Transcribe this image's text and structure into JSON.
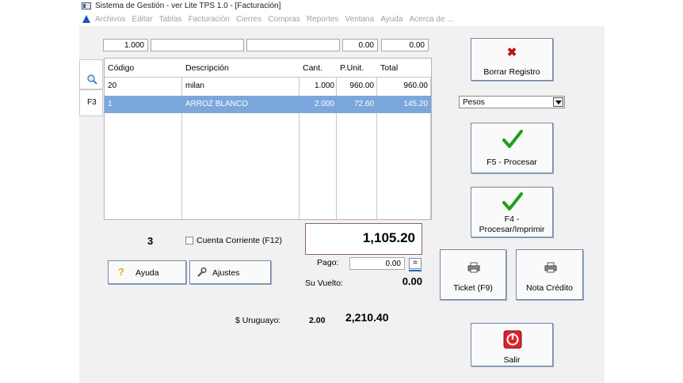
{
  "window": {
    "title": "Sistema de Gestión - ver Lite TPS 1.0 - [Facturación]"
  },
  "menu": {
    "items": [
      "Archivos",
      "Editar",
      "Tablas",
      "Facturación",
      "Cierres",
      "Compras",
      "Reportes",
      "Ventana",
      "Ayuda",
      "Acerca de ..."
    ]
  },
  "entry": {
    "quantity": "1.000",
    "code": "",
    "description": "",
    "price": "0.00",
    "total": "0.00"
  },
  "grid": {
    "headers": [
      "Código",
      "Descripción",
      "Cant.",
      "P.Unit.",
      "Total"
    ],
    "rows": [
      {
        "code": "20",
        "description": "milan",
        "qty": "1.000",
        "unit": "960.00",
        "total": "960.00",
        "selected": false
      },
      {
        "code": "1",
        "description": "ARROZ BLANCO",
        "qty": "2.000",
        "unit": "72.60",
        "total": "145.20",
        "selected": true
      }
    ]
  },
  "sidetabs": {
    "search_icon": "magnifier-icon",
    "f3_label": "F3"
  },
  "summary": {
    "item_count": "3",
    "checkbox_label": "Cuenta Corriente (F12)",
    "total": "1,105.20",
    "pago_label": "Pago:",
    "pago_value": "0.00",
    "equals_label": "=",
    "vuelto_label": "Su Vuelto:",
    "vuelto_value": "0.00",
    "currency_label": "$ Uruguayo:",
    "rate": "2.00",
    "converted": "2,210.40"
  },
  "buttons": {
    "help": "Ayuda",
    "settings": "Ajustes",
    "delete": "Borrar Registro",
    "process": "F5 - Procesar",
    "process_print_line1": "F4 -",
    "process_print_line2": "Procesar/Imprimir",
    "ticket": "Ticket (F9)",
    "credit_note": "Nota Crédito",
    "exit": "Salir"
  },
  "currency_select": {
    "value": "Pesos"
  },
  "colors": {
    "selected_row": "#7ba7dc",
    "check_green": "#1f9e1f",
    "delete_red": "#c0121c",
    "exit_red": "#d8242a",
    "window_bg": "#f1f1f1"
  }
}
